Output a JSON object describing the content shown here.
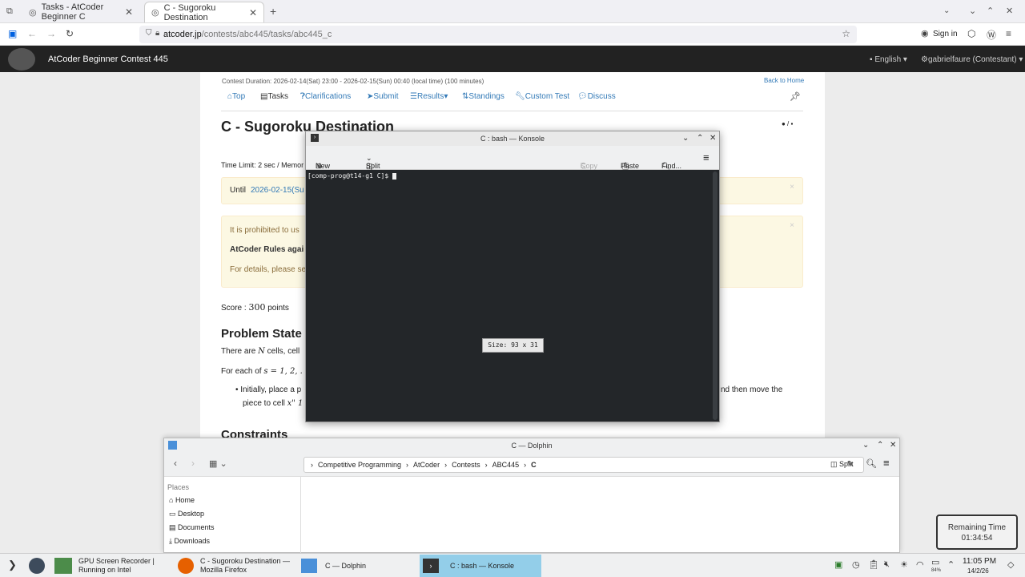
{
  "browser": {
    "tabs": [
      {
        "label": "Tasks - AtCoder Beginner C"
      },
      {
        "label": "C - Sugoroku Destination"
      }
    ],
    "url_host": "atcoder.jp",
    "url_path": "/contests/abc445/tasks/abc445_c",
    "sign_in": "Sign in"
  },
  "atcoder": {
    "title": "AtCoder Beginner Contest 445",
    "language": "English",
    "user": "gabrielfaure (Contestant)",
    "duration": "Contest Duration: 2026-02-14(Sat) 23:00 - 2026-02-15(Sun) 00:40 (local time) (100 minutes)",
    "back_home": "Back to Home",
    "nav": [
      "Top",
      "Tasks",
      "Clarifications",
      "Submit",
      "Results",
      "Standings",
      "Custom Test",
      "Discuss"
    ],
    "task_title": "C - Sugoroku Destination",
    "time_limit": "Time Limit: 2 sec / Memor",
    "until": "Until",
    "until_date": "2026-02-15(Su",
    "prohibited": "It is prohibited to us",
    "rules": "AtCoder Rules agai",
    "details": "For details, please se",
    "score_label": "Score :",
    "score_value": "300",
    "score_unit": "points",
    "problem_heading": "Problem State",
    "line1": "There are",
    "line1_var": "N",
    "line1_rest": "cells, cell",
    "line2": "For each of",
    "line2_math": "s = 1, 2, .",
    "bullet": "Initially, place a p",
    "bullet_cont": "piece to cell",
    "bullet_math": "x\" 1",
    "bullet_right": "nd then move the",
    "constraints": "Constraints"
  },
  "konsole": {
    "title": "C : bash — Konsole",
    "new_tab": "New Tab",
    "split_view": "Split View",
    "copy": "Copy",
    "paste": "Paste",
    "find": "Find...",
    "prompt": "[comp-prog@t14-g1 C]$",
    "size": "Size: 93 x 31"
  },
  "dolphin": {
    "title": "C — Dolphin",
    "crumbs": [
      "Competitive Programming",
      "AtCoder",
      "Contests",
      "ABC445",
      "C"
    ],
    "split": "Split",
    "places_header": "Places",
    "places": [
      "Home",
      "Desktop",
      "Documents",
      "Downloads"
    ]
  },
  "timer": {
    "label": "Remaining Time",
    "value": "01:34:54"
  },
  "taskbar": {
    "items": [
      {
        "line1": "GPU Screen Recorder |",
        "line2": "Running on Intel"
      },
      {
        "line1": "C - Sugoroku Destination —",
        "line2": "Mozilla Firefox"
      },
      {
        "line1": "C — Dolphin",
        "line2": ""
      },
      {
        "line1": "C : bash — Konsole",
        "line2": ""
      }
    ],
    "time": "11:05 PM",
    "date": "14/2/26",
    "battery": "84%"
  }
}
